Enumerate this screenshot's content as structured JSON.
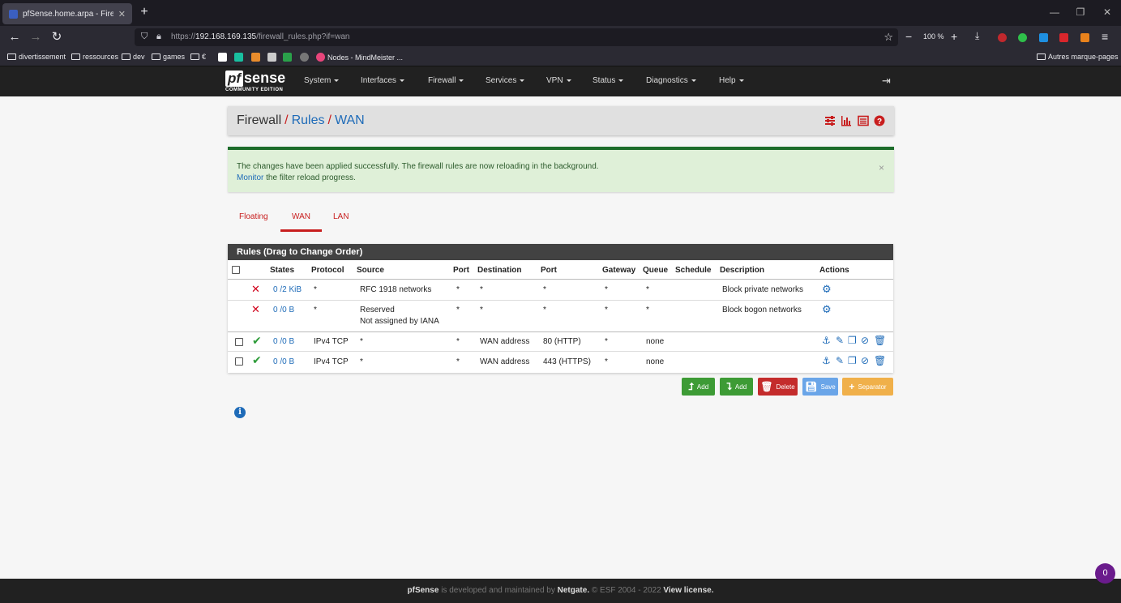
{
  "browser": {
    "tab_title": "pfSense.home.arpa - Firewall: R",
    "url_prefix": "https://",
    "url_host": "192.168.169.135",
    "url_path": "/firewall_rules.php?if=wan",
    "zoom": "100 %",
    "bookmarks": [
      "divertissement",
      "ressources",
      "dev",
      "games",
      "€"
    ],
    "bookmark_site": "Nodes - MindMeister ...",
    "other_bookmarks": "Autres marque-pages"
  },
  "pf": {
    "logo_pf": "pf",
    "logo_sense": "sense",
    "logo_edition": "COMMUNITY EDITION",
    "menu": [
      "System",
      "Interfaces",
      "Firewall",
      "Services",
      "VPN",
      "Status",
      "Diagnostics",
      "Help"
    ]
  },
  "breadcrumb": {
    "root": "Firewall",
    "sep": "/",
    "level1": "Rules",
    "level2": "WAN"
  },
  "alert": {
    "line1": "The changes have been applied successfully. The firewall rules are now reloading in the background.",
    "monitor": "Monitor",
    "line2_rest": " the filter reload progress.",
    "close": "×"
  },
  "iface_tabs": [
    "Floating",
    "WAN",
    "LAN"
  ],
  "rules": {
    "title": "Rules (Drag to Change Order)",
    "headers": [
      "States",
      "Protocol",
      "Source",
      "Port",
      "Destination",
      "Port",
      "Gateway",
      "Queue",
      "Schedule",
      "Description",
      "Actions"
    ],
    "rows": [
      {
        "status": "block",
        "states": "0 /2 KiB",
        "protocol": "*",
        "source": "RFC 1918 networks",
        "source2": "",
        "sport": "*",
        "dest": "*",
        "dport": "*",
        "gateway": "*",
        "queue": "*",
        "schedule": "",
        "description": "Block private networks"
      },
      {
        "status": "block",
        "states": "0 /0 B",
        "protocol": "*",
        "source": "Reserved",
        "source2": "Not assigned by IANA",
        "sport": "*",
        "dest": "*",
        "dport": "*",
        "gateway": "*",
        "queue": "*",
        "schedule": "",
        "description": "Block bogon networks"
      },
      {
        "status": "pass",
        "states": "0 /0 B",
        "protocol": "IPv4 TCP",
        "source": "*",
        "source2": "",
        "sport": "*",
        "dest": "WAN address",
        "dport": "80 (HTTP)",
        "gateway": "*",
        "queue": "none",
        "schedule": "",
        "description": ""
      },
      {
        "status": "pass",
        "states": "0 /0 B",
        "protocol": "IPv4 TCP",
        "source": "*",
        "source2": "",
        "sport": "*",
        "dest": "WAN address",
        "dport": "443 (HTTPS)",
        "gateway": "*",
        "queue": "none",
        "schedule": "",
        "description": ""
      }
    ]
  },
  "buttons": {
    "add_top": "Add",
    "add_bottom": "Add",
    "delete": "Delete",
    "save": "Save",
    "separator": "Separator"
  },
  "footer": {
    "brand": "pfSense",
    "mid": " is developed and maintained by ",
    "company": "Netgate.",
    "copy": " © ESF 2004 - 2022 ",
    "license": "View license."
  },
  "notification_count": "0",
  "colors": {
    "accent_red": "#c81e1e",
    "link_blue": "#1e6bb8",
    "nav_dark": "#212121",
    "success_green": "#3d9b35"
  }
}
